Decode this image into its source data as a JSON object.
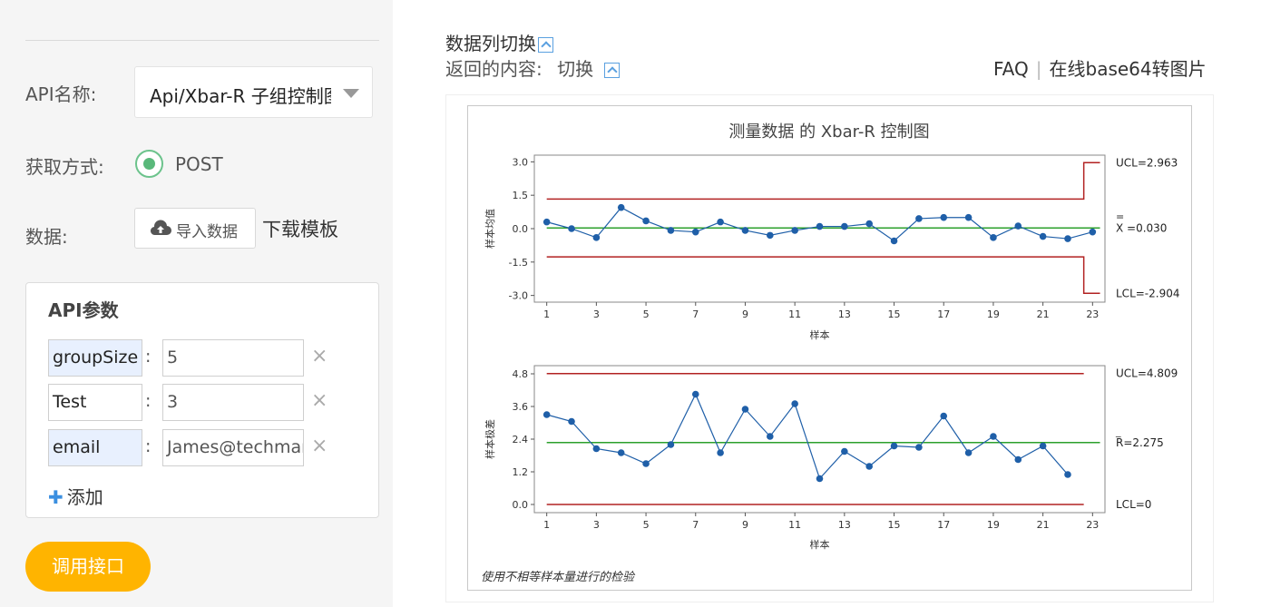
{
  "left": {
    "api_name_label": "API名称:",
    "api_name_value": "Api/Xbar-R 子组控制图",
    "method_label": "获取方式:",
    "method_value": "POST",
    "data_label": "数据:",
    "import_button": "导入数据",
    "download_template": "下载模板",
    "params": {
      "title": "API参数",
      "rows": [
        {
          "key": "groupSize",
          "value": "5",
          "highlight": true
        },
        {
          "key": "Test",
          "value": "3",
          "highlight": false
        },
        {
          "key": "email",
          "value": "James@techmark.com",
          "highlight": true
        }
      ],
      "colon": ":",
      "remove": "×",
      "add_label": "添加",
      "add_icon": "plus-icon"
    },
    "call_button": "调用接口"
  },
  "right": {
    "title": "数据列切换",
    "sub_label": "返回的内容:",
    "sub_value": "切换",
    "faq": "FAQ",
    "separator": "|",
    "base64_link": "在线base64转图片"
  },
  "chart_data": [
    {
      "type": "line",
      "title": "测量数据 的 Xbar-R 控制图",
      "xlabel": "样本",
      "ylabel": "样本均值",
      "x": [
        1,
        2,
        3,
        4,
        5,
        6,
        7,
        8,
        9,
        10,
        11,
        12,
        13,
        14,
        15,
        16,
        17,
        18,
        19,
        20,
        21,
        22,
        23
      ],
      "values": [
        0.3,
        0.0,
        -0.4,
        0.95,
        0.35,
        -0.08,
        -0.15,
        0.3,
        -0.08,
        -0.3,
        -0.08,
        0.1,
        0.1,
        0.22,
        -0.55,
        0.45,
        0.5,
        0.5,
        -0.4,
        0.12,
        -0.35,
        -0.45,
        -0.15
      ],
      "ylim": [
        -3.3,
        3.3
      ],
      "yticks": [
        "3.0",
        "1.5",
        "0.0",
        "-1.5",
        "-3.0"
      ],
      "ytick_values": [
        3.0,
        1.5,
        0.0,
        -1.5,
        -3.0
      ],
      "xticks": [
        "1",
        "3",
        "5",
        "7",
        "9",
        "11",
        "13",
        "15",
        "17",
        "19",
        "21",
        "23"
      ],
      "ucl": 1.33,
      "ucl_last": 2.963,
      "lcl": -1.27,
      "lcl_last": -2.904,
      "center": 0.03,
      "labels": {
        "ucl": "UCL=2.963",
        "center_bar": "=",
        "center": "X =0.030",
        "lcl": "LCL=-2.904"
      },
      "colors": {
        "limit": "#b22222",
        "center": "#2ca02c",
        "series": "#1f5fa8"
      }
    },
    {
      "type": "line",
      "xlabel": "样本",
      "ylabel": "样本极差",
      "x": [
        1,
        2,
        3,
        4,
        5,
        6,
        7,
        8,
        9,
        10,
        11,
        12,
        13,
        14,
        15,
        16,
        17,
        18,
        19,
        20,
        21,
        22
      ],
      "values": [
        3.3,
        3.05,
        2.05,
        1.9,
        1.5,
        2.2,
        4.05,
        1.9,
        3.5,
        2.5,
        3.7,
        0.95,
        1.95,
        1.4,
        2.15,
        2.1,
        3.25,
        1.9,
        2.5,
        1.65,
        2.15,
        1.1
      ],
      "ylim": [
        -0.3,
        5.1
      ],
      "yticks": [
        "4.8",
        "3.6",
        "2.4",
        "1.2",
        "0.0"
      ],
      "ytick_values": [
        4.8,
        3.6,
        2.4,
        1.2,
        0.0
      ],
      "xticks": [
        "1",
        "3",
        "5",
        "7",
        "9",
        "11",
        "13",
        "15",
        "17",
        "19",
        "21",
        "23"
      ],
      "ucl": 4.809,
      "lcl": 0,
      "center": 2.275,
      "labels": {
        "ucl": "UCL=4.809",
        "center_bar": "_",
        "center": "R=2.275",
        "lcl": "LCL=0"
      },
      "colors": {
        "limit": "#b22222",
        "center": "#2ca02c",
        "series": "#1f5fa8"
      },
      "footnote": "使用不相等样本量进行的检验"
    }
  ]
}
